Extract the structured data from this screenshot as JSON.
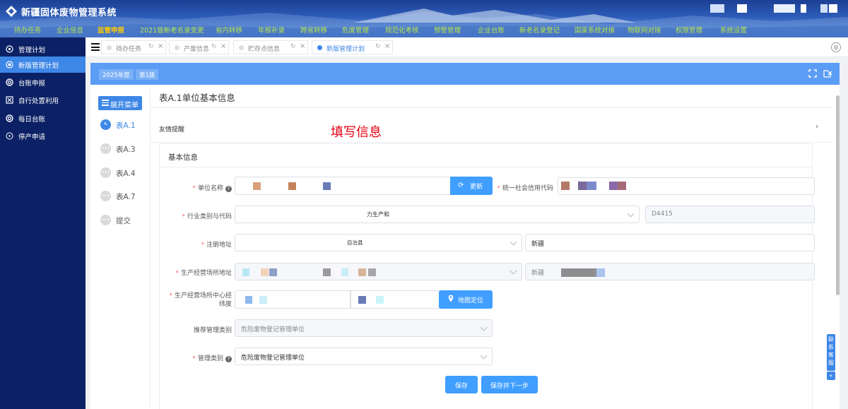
{
  "header": {
    "title": "新疆固体废物管理系统",
    "nav": [
      {
        "label": "待办任务",
        "active": false
      },
      {
        "label": "企业信息",
        "active": false
      },
      {
        "label": "监管申报",
        "active": true
      },
      {
        "label": "2021版新老名录变更",
        "active": false
      },
      {
        "label": "省内转移",
        "active": false
      },
      {
        "label": "年报补录",
        "active": false
      },
      {
        "label": "跨省转移",
        "active": false
      },
      {
        "label": "危废管理",
        "active": false
      },
      {
        "label": "规范化考核",
        "active": false
      },
      {
        "label": "预警管理",
        "active": false
      },
      {
        "label": "企业台账",
        "active": false
      },
      {
        "label": "新老名录登记",
        "active": false
      },
      {
        "label": "国家系统对接",
        "active": false
      },
      {
        "label": "物联网对接",
        "active": false
      },
      {
        "label": "权限管理",
        "active": false
      },
      {
        "label": "系统设置",
        "active": false
      }
    ]
  },
  "sidebar": {
    "items": [
      {
        "label": "管理计划",
        "icon": "gear-icon",
        "active": false
      },
      {
        "label": "新版管理计划",
        "icon": "circle-dot-icon",
        "active": true
      },
      {
        "label": "台账申报",
        "icon": "target-icon",
        "active": false
      },
      {
        "label": "自行处置利用",
        "icon": "box-x-icon",
        "active": false
      },
      {
        "label": "每日台账",
        "icon": "target-icon",
        "active": false
      },
      {
        "label": "停产申请",
        "icon": "dot-circle-icon",
        "active": false
      }
    ]
  },
  "tabs": [
    {
      "label": "待办任务",
      "active": false
    },
    {
      "label": "产废信息",
      "active": false
    },
    {
      "label": "贮存点信息",
      "active": false
    },
    {
      "label": "新版管理计划",
      "active": true
    }
  ],
  "tab_refresh_glyph": "↻",
  "tab_close_glyph": "×",
  "bluebar": {
    "year_tag": "2025年度",
    "version_tag": "第1版"
  },
  "left_panel": {
    "expand_menu_label": "展开菜单",
    "steps": [
      {
        "label": "表A.1",
        "active": true
      },
      {
        "label": "表A.3",
        "active": false
      },
      {
        "label": "表A.4",
        "active": false
      },
      {
        "label": "表A.7",
        "active": false
      },
      {
        "label": "提交",
        "active": false
      }
    ]
  },
  "form": {
    "title": "表A.1单位基本信息",
    "reminder_label": "友情提醒",
    "annotation": "填写信息",
    "section_title": "基本信息",
    "labels": {
      "unit_name": "单位名称",
      "credit_code": "统一社会信用代码",
      "industry": "行业类别与代码",
      "reg_address": "注册地址",
      "op_address": "生产经营场所地址",
      "center_coord_line1": "生产经营场所中心经",
      "center_coord_line2": "纬度",
      "recommended_type": "推荐管理类别",
      "management_type": "管理类别"
    },
    "values": {
      "industry_name": "力生产和",
      "industry_code": "D4415",
      "reg_address_text": "自治县",
      "reg_address_detail_prefix": "新疆",
      "op_address_detail_prefix": "新疆",
      "recommended_type": "危险废物登记管理单位",
      "management_type": "危险废物登记管理单位"
    },
    "update_button": "更新",
    "map_button": "地图定位",
    "save_button": "保存",
    "save_next_button": "保存并下一步"
  },
  "floating": {
    "contact_service": "联系客服",
    "collapse": "«"
  },
  "colors": {
    "primary": "#409eff",
    "sidebar_bg": "#0c2165",
    "sidebar_active": "#3d87e6",
    "nav_text": "#b8e64c",
    "nav_active": "#ffcc00",
    "annotation": "#e60012",
    "required": "#f56c6c"
  }
}
